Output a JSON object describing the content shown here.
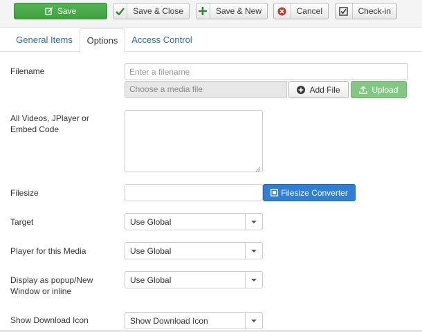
{
  "toolbar": {
    "save": "Save",
    "save_close": "Save & Close",
    "save_new": "Save & New",
    "cancel": "Cancel",
    "checkin": "Check-in"
  },
  "tabs": [
    "General Items",
    "Options",
    "Access Control"
  ],
  "active_tab": "Options",
  "form": {
    "filename": {
      "label": "Filename",
      "placeholder": "Enter a filename",
      "media_placeholder": "Choose a media file",
      "add_file": "Add File",
      "upload": "Upload"
    },
    "videos": {
      "label": "All Videos, JPlayer or Embed Code",
      "value": ""
    },
    "filesize": {
      "label": "Filesize",
      "value": "",
      "converter": "Filesize Converter"
    },
    "target": {
      "label": "Target",
      "value": "Use Global"
    },
    "player": {
      "label": "Player for this Media",
      "value": "Use Global"
    },
    "display": {
      "label": "Display as popup/New Window or inline",
      "value": "Use Global"
    },
    "download_icon": {
      "label": "Show Download Icon",
      "value": "Show Download Icon"
    }
  },
  "colors": {
    "save_green": "#46a546",
    "upload_green": "#82c782",
    "converter_blue": "#2f7fd6",
    "link_blue": "#2a69b8",
    "cancel_red": "#c0392b"
  },
  "icons": {
    "save": "edit-icon",
    "save_close": "check-icon",
    "save_new": "plus-icon",
    "cancel": "cancel-circle-icon",
    "checkin": "checkbox-icon",
    "add_file": "plus-circle-icon",
    "upload": "upload-icon",
    "converter": "square-icon"
  }
}
